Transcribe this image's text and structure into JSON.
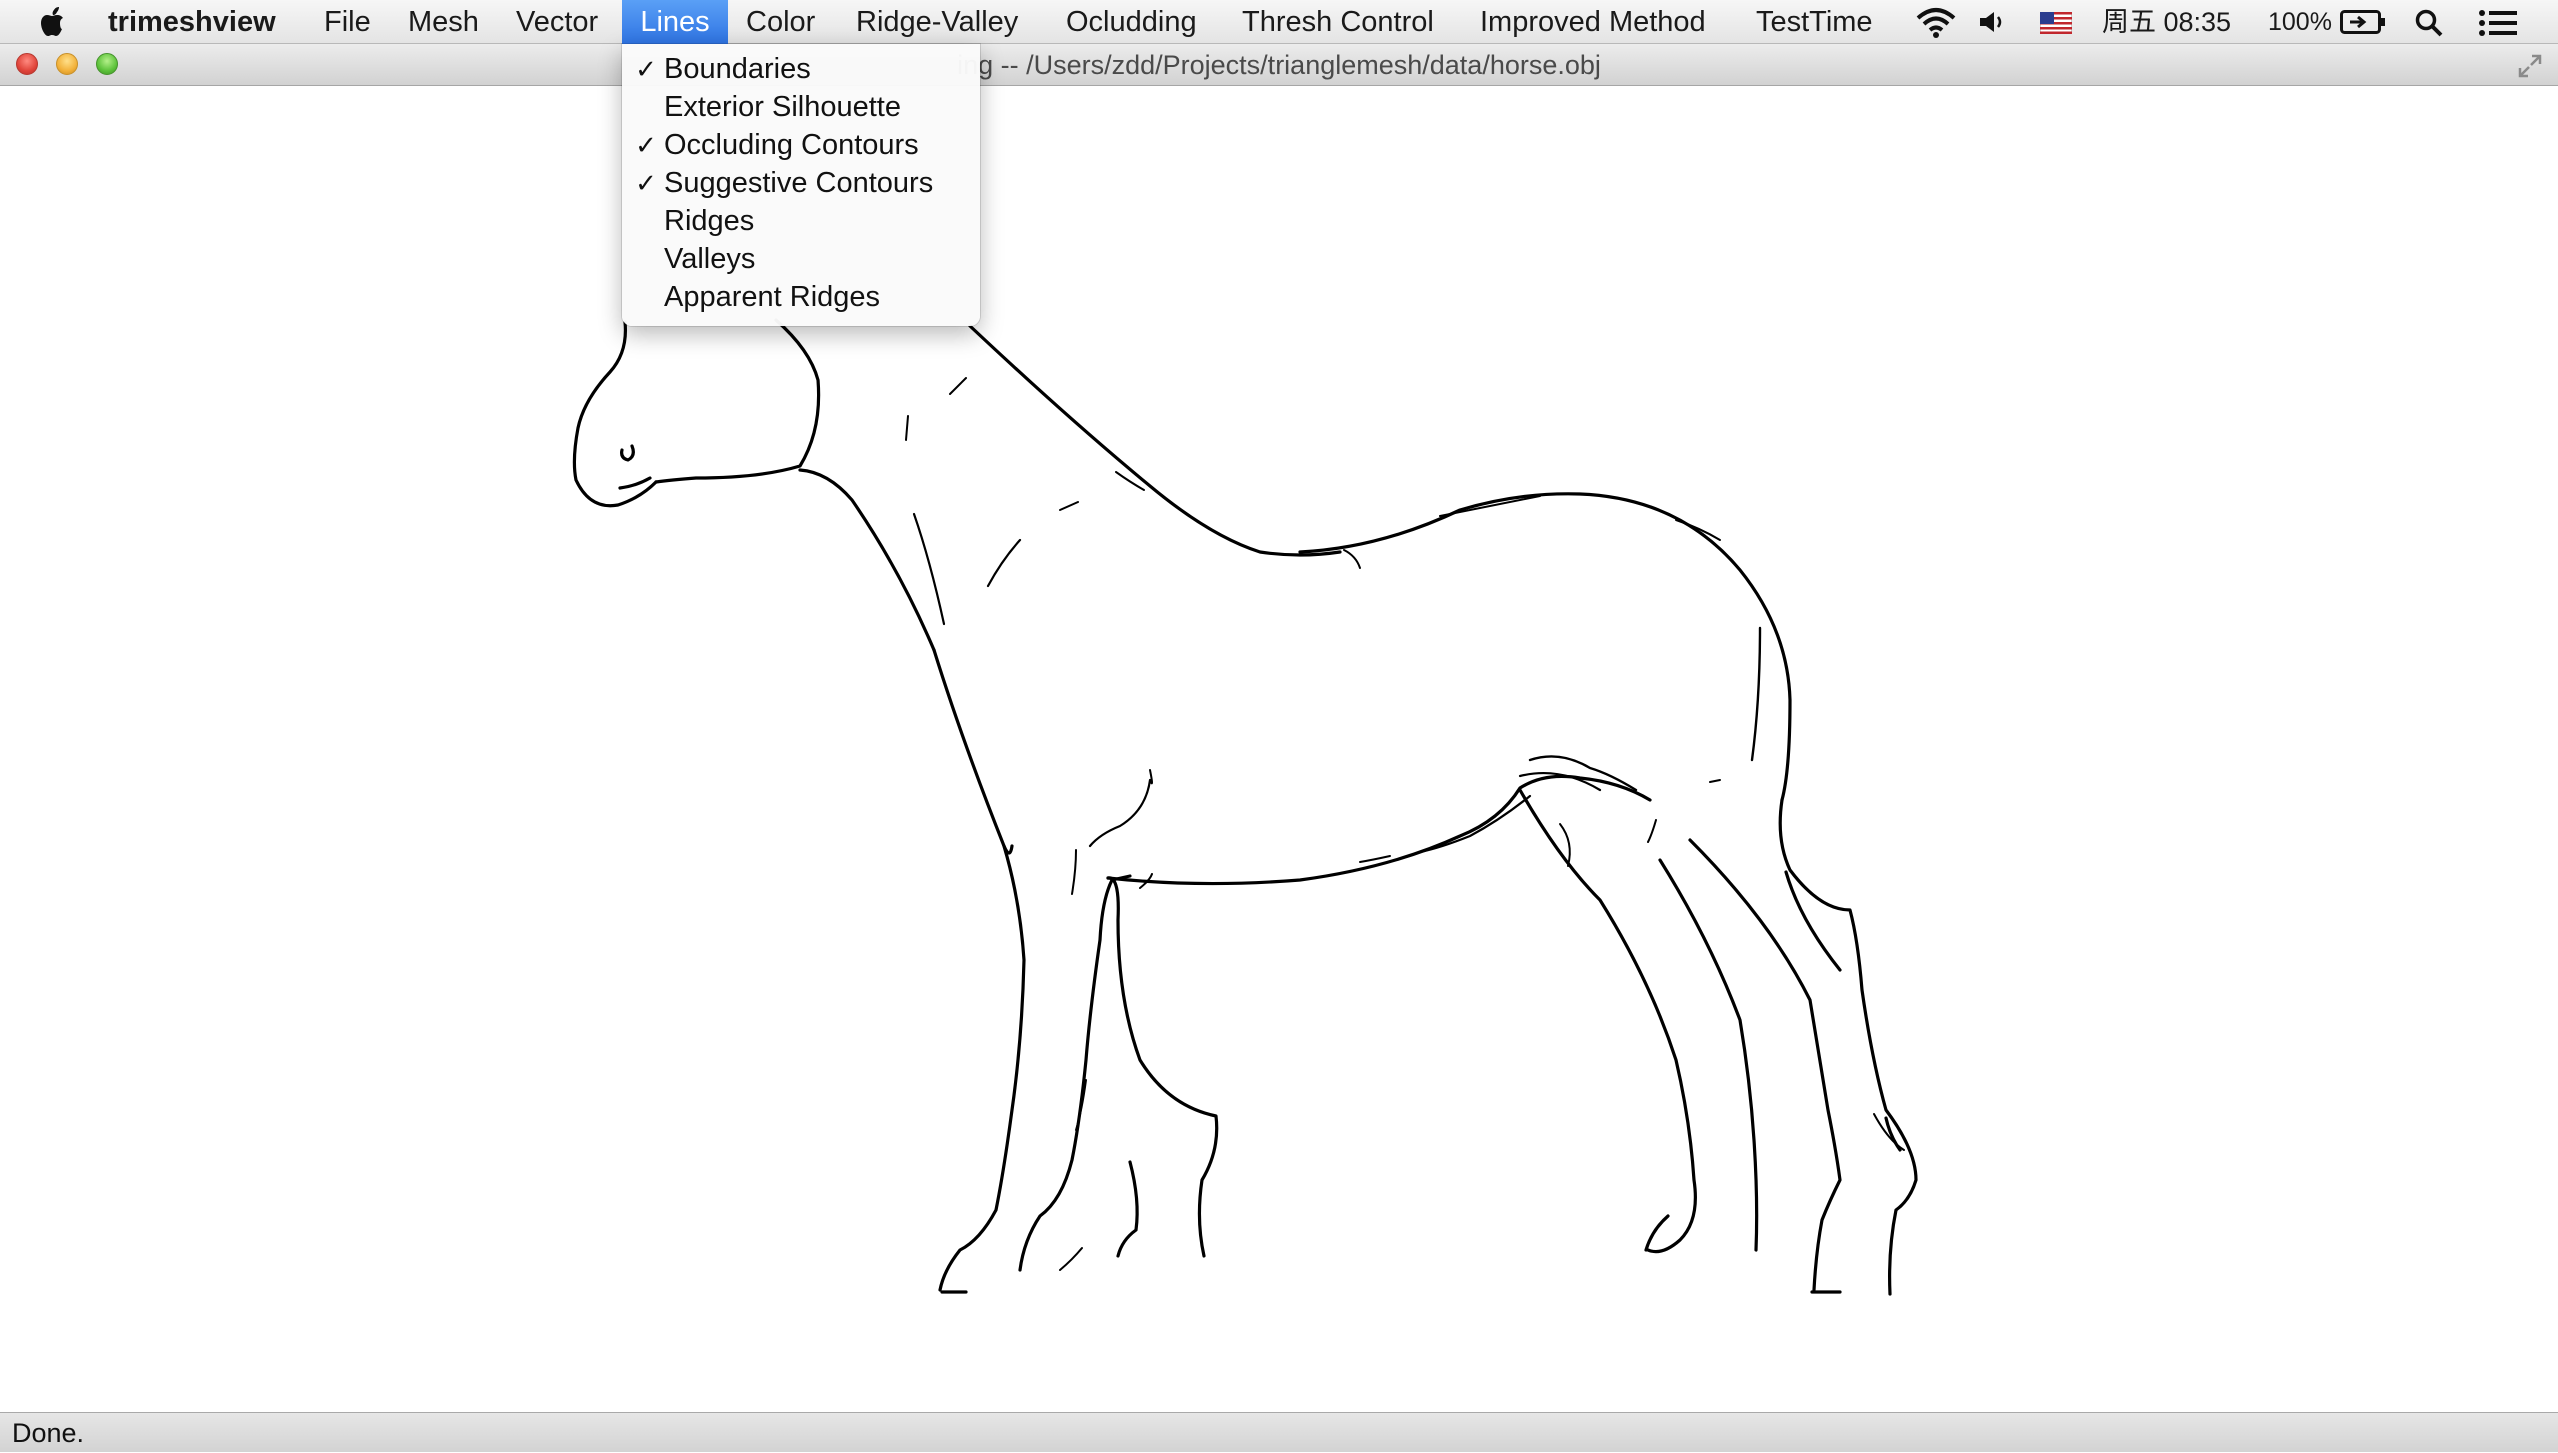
{
  "menubar": {
    "app_name": "trimeshview",
    "menus": [
      "File",
      "Mesh",
      "Vector",
      "Lines",
      "Color",
      "Ridge-Valley",
      "Ocludding",
      "Thresh Control",
      "Improved Method",
      "TestTime"
    ],
    "active_menu": "Lines",
    "status": {
      "clock": "周五 08:35",
      "battery": "100%",
      "icons": [
        "wifi-icon",
        "volume-icon",
        "flag-us-icon",
        "battery-charging-icon",
        "spotlight-search-icon",
        "notification-list-icon"
      ]
    }
  },
  "window": {
    "title": "ing -- /Users/zdd/Projects/trianglemesh/data/horse.obj"
  },
  "lines_menu": {
    "items": [
      {
        "label": "Boundaries",
        "checked": true,
        "check": "✓"
      },
      {
        "label": "Exterior Silhouette",
        "checked": false,
        "check": ""
      },
      {
        "label": "Occluding Contours",
        "checked": true,
        "check": "✓"
      },
      {
        "label": "Suggestive Contours",
        "checked": true,
        "check": "✓"
      },
      {
        "label": "Ridges",
        "checked": false,
        "check": ""
      },
      {
        "label": "Valleys",
        "checked": false,
        "check": ""
      },
      {
        "label": "Apparent Ridges",
        "checked": false,
        "check": ""
      }
    ]
  },
  "statusbar": {
    "text": "Done."
  },
  "colors": {
    "menu_highlight": "#3a80ec",
    "line_color": "#000000",
    "canvas_bg": "#ffffff"
  }
}
